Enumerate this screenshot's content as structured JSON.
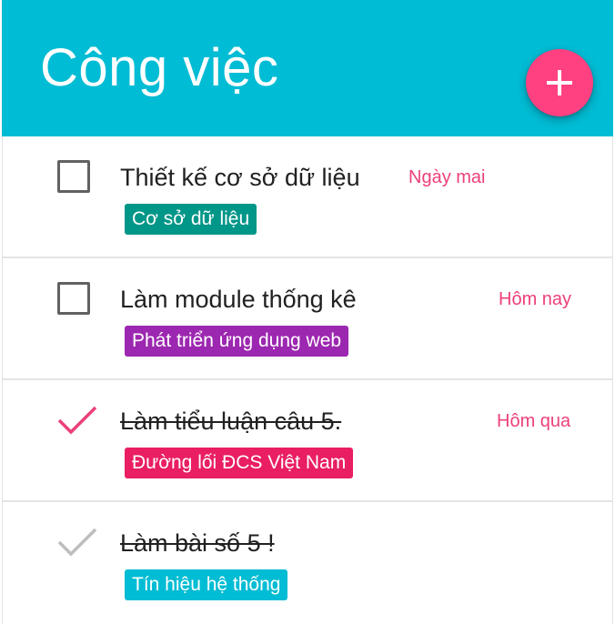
{
  "header": {
    "title": "Công việc",
    "add_icon": "plus-icon"
  },
  "tasks": [
    {
      "title": "Thiết kế cơ sở dữ liệu",
      "due": "Ngày mai",
      "tag": "Cơ sở dữ liệu",
      "tag_color": "#009688",
      "completed": false
    },
    {
      "title": "Làm module thống kê",
      "due": "Hôm nay",
      "tag": "Phát triển ứng dụng web",
      "tag_color": "#9c27b0",
      "completed": false
    },
    {
      "title": "Làm tiểu luận câu 5.",
      "due": "Hôm qua",
      "tag": "Đường lối ĐCS Việt Nam",
      "tag_color": "#e91e63",
      "completed": true
    },
    {
      "title": "Làm bài số 5 !",
      "due": "",
      "tag": "Tín hiệu hệ thống",
      "tag_color": "#00bcd4",
      "completed": true
    }
  ],
  "colors": {
    "header": "#00bcd4",
    "accent": "#ff4081",
    "due_text": "#ec407a",
    "check_active": "#ec407a",
    "check_muted": "#bdbdbd"
  }
}
